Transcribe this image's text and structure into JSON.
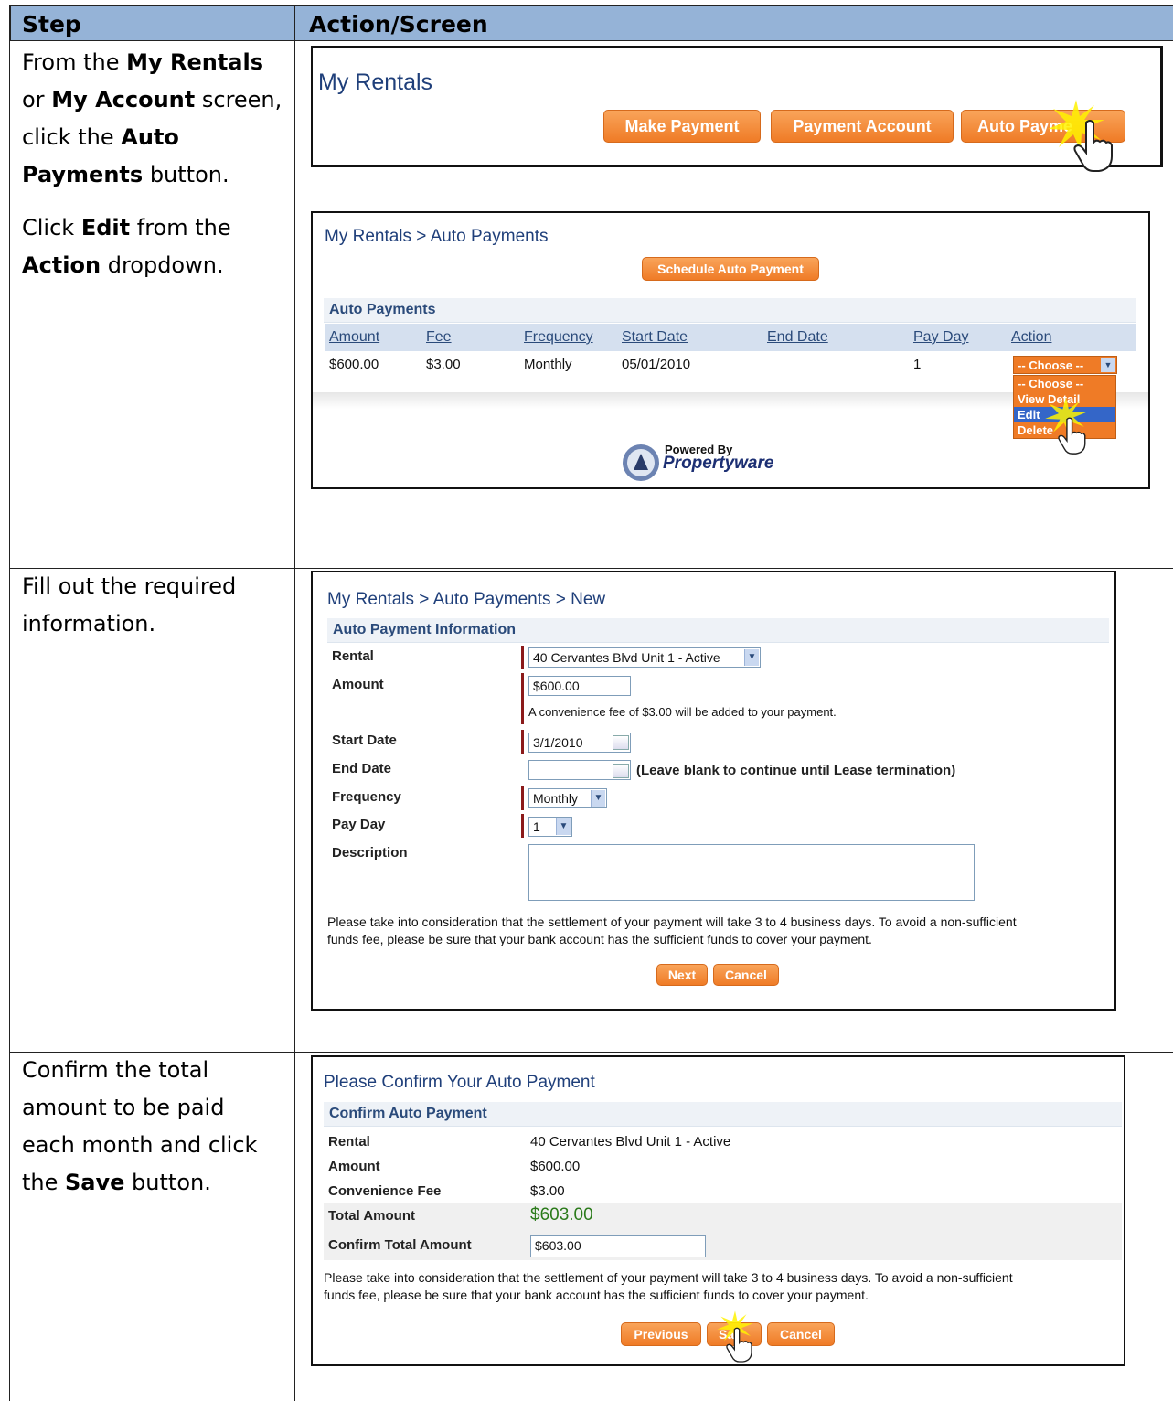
{
  "header": {
    "step": "Step",
    "action": "Action/Screen"
  },
  "rows": [
    {
      "step_parts": [
        "From the ",
        "My Rentals",
        " or ",
        "My Account",
        " screen, click the ",
        "Auto Payments",
        " button."
      ]
    },
    {
      "step_parts": [
        "Click ",
        "Edit",
        " from the ",
        "Action",
        " dropdown."
      ]
    },
    {
      "step_parts": [
        "Fill out the required information."
      ]
    },
    {
      "step_parts": [
        "Confirm the total amount to be paid each month and click the ",
        "Save",
        " button."
      ]
    }
  ],
  "shot1": {
    "title": "My Rentals",
    "buttons": [
      "Make Payment",
      "Payment Account",
      "Auto Payme"
    ]
  },
  "shot2": {
    "breadcrumb": "My Rentals > Auto Payments",
    "schedule_button": "Schedule Auto Payment",
    "section": "Auto Payments",
    "columns": [
      "Amount",
      "Fee",
      "Frequency",
      "Start Date",
      "End Date",
      "Pay Day",
      "Action"
    ],
    "row": {
      "amount": "$600.00",
      "fee": "$3.00",
      "frequency": "Monthly",
      "start_date": "05/01/2010",
      "end_date": "",
      "pay_day": "1"
    },
    "action_select": "-- Choose --",
    "action_options": [
      "-- Choose --",
      "View Detail",
      "Edit",
      "Delete"
    ],
    "powered_by": "Powered By",
    "brand": "Propertyware"
  },
  "shot3": {
    "breadcrumb": "My Rentals > Auto Payments > New",
    "section": "Auto Payment Information",
    "labels": {
      "rental": "Rental",
      "amount": "Amount",
      "start": "Start Date",
      "end": "End Date",
      "frequency": "Frequency",
      "payday": "Pay Day",
      "description": "Description"
    },
    "values": {
      "rental": "40 Cervantes Blvd Unit 1 - Active",
      "amount": "$600.00",
      "start": "3/1/2010",
      "end": "",
      "frequency": "Monthly",
      "payday": "1"
    },
    "fee_note": "A convenience fee of $3.00 will be added to your payment.",
    "end_note": "(Leave blank to continue until Lease termination)",
    "disclaimer_1": "Please take into consideration that the settlement of your payment will take 3 to 4 business days. To avoid a non-sufficient",
    "disclaimer_2": "funds fee, please be sure that your bank account has the sufficient funds to cover your payment.",
    "next": "Next",
    "cancel": "Cancel"
  },
  "shot4": {
    "title": "Please Confirm Your Auto Payment",
    "section": "Confirm Auto Payment",
    "labels": {
      "rental": "Rental",
      "amount": "Amount",
      "fee": "Convenience Fee",
      "total": "Total Amount",
      "confirm": "Confirm Total Amount"
    },
    "values": {
      "rental": "40 Cervantes Blvd Unit 1 - Active",
      "amount": "$600.00",
      "fee": "$3.00",
      "total": "$603.00",
      "confirm": "$603.00"
    },
    "disclaimer_1": "Please take into consideration that the settlement of your payment will take 3 to 4 business days. To avoid a non-sufficient",
    "disclaimer_2": "funds fee, please be sure that your bank account has the sufficient funds to cover your payment.",
    "previous": "Previous",
    "save": "Sa",
    "cancel": "Cancel"
  },
  "colors": {
    "header_bg": "#95b3d7",
    "orange": "#ef7b26",
    "title_blue": "#1f3f7a",
    "total_green": "#2a7a1a"
  }
}
